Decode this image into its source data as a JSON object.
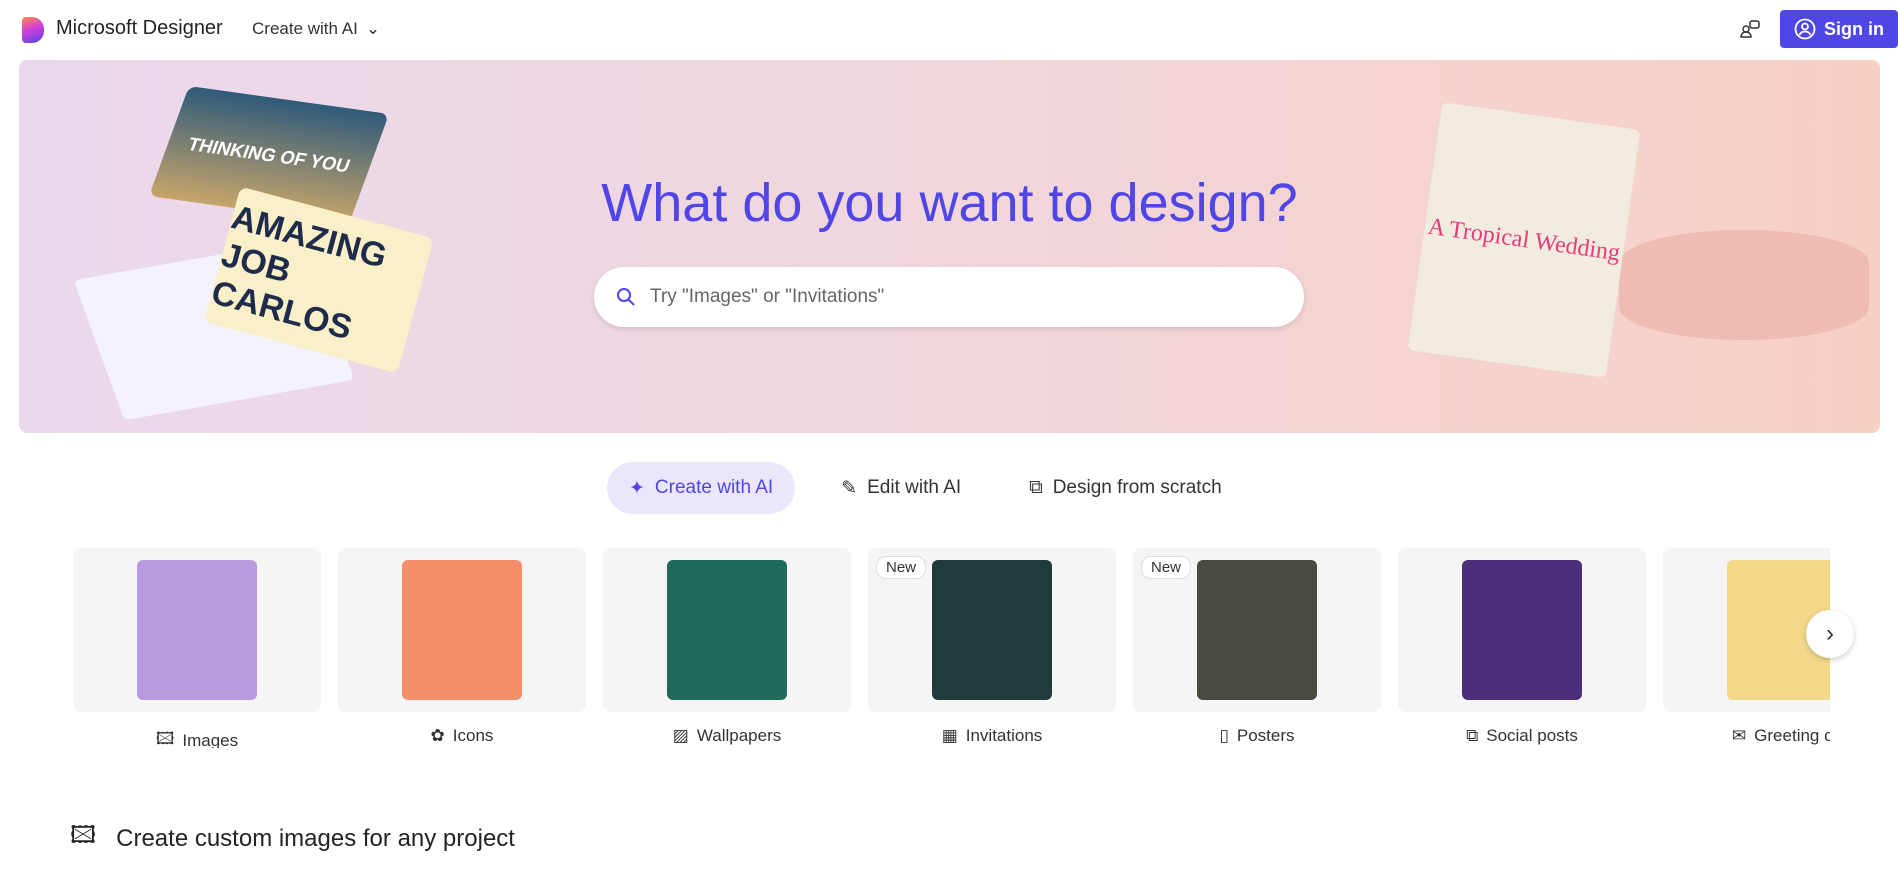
{
  "header": {
    "brand": "Microsoft Designer",
    "nav_create": "Create with AI",
    "signin": "Sign in"
  },
  "hero": {
    "title": "What do you want to design?",
    "search_placeholder": "Try \"Images\" or \"Invitations\"",
    "deco_texts": [
      "THINKING OF YOU",
      "AMAZING JOB CARLOS",
      "A Tropical Wedding"
    ]
  },
  "tabs": [
    {
      "label": "Create with AI",
      "active": true
    },
    {
      "label": "Edit with AI"
    },
    {
      "label": "Design from scratch"
    }
  ],
  "cards": [
    {
      "label": "Images",
      "icon": "image-sparkle-icon",
      "color": "#b99ae0"
    },
    {
      "label": "Icons",
      "icon": "icons-icon",
      "color": "#f58e6a"
    },
    {
      "label": "Wallpapers",
      "icon": "wallpaper-icon",
      "color": "#1f6a5a"
    },
    {
      "label": "Invitations",
      "icon": "calendar-icon",
      "badge": "New",
      "color": "#1f3b3a"
    },
    {
      "label": "Posters",
      "icon": "poster-icon",
      "badge": "New",
      "color": "#4a4a40"
    },
    {
      "label": "Social posts",
      "icon": "social-icon",
      "color": "#4b2f7a"
    },
    {
      "label": "Greeting ca",
      "icon": "mail-icon",
      "color": "#f3d88a"
    }
  ],
  "section": {
    "title": "Create custom images for any project"
  },
  "colors": {
    "accent": "#4f46e5",
    "tab_active_bg": "#ece6fd"
  }
}
